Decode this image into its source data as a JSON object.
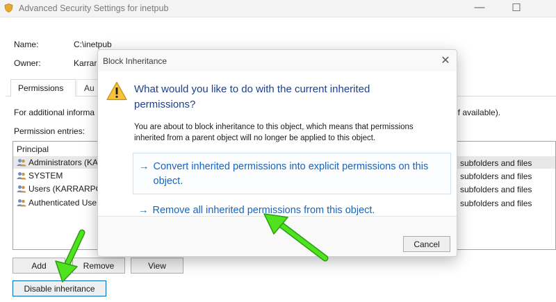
{
  "window": {
    "title": "Advanced Security Settings for inetpub",
    "minimize_glyph": "—",
    "maximize_glyph": "☐"
  },
  "props": {
    "name_label": "Name:",
    "name_value": "C:\\inetpub",
    "owner_label": "Owner:",
    "owner_value": "Karrar"
  },
  "tabs": [
    {
      "label": "Permissions"
    },
    {
      "label": "Au"
    }
  ],
  "info_text": "For additional informa",
  "info_tail": "if available).",
  "entries_label": "Permission entries:",
  "list": {
    "header": "Principal",
    "rows": [
      {
        "principal": "Administrators (KA",
        "applies": "subfolders and files"
      },
      {
        "principal": "SYSTEM",
        "applies": "subfolders and files"
      },
      {
        "principal": "Users (KARRARPC\\",
        "applies": "subfolders and files"
      },
      {
        "principal": "Authenticated User",
        "applies": "subfolders and files"
      }
    ]
  },
  "buttons": {
    "add": "Add",
    "remove": "Remove",
    "view": "View",
    "disable_inheritance": "Disable inheritance"
  },
  "dialog": {
    "title": "Block Inheritance",
    "close_glyph": "✕",
    "question": "What would you like to do with the current inherited permissions?",
    "description": "You are about to block inheritance to this object, which means that permissions inherited from a parent object will no longer be applied to this object.",
    "option_convert": "Convert inherited permissions into explicit permissions on this object.",
    "option_remove": "Remove all inherited permissions from this object.",
    "arrow_glyph": "→",
    "cancel": "Cancel"
  },
  "colors": {
    "link": "#1764c0",
    "question": "#1c3f8f",
    "annotation_arrow": "#3fdc1e",
    "warning": "#f6c33b"
  },
  "icons": {
    "warning": "warning-icon",
    "users": "users-icon",
    "shield": "shield-icon"
  }
}
